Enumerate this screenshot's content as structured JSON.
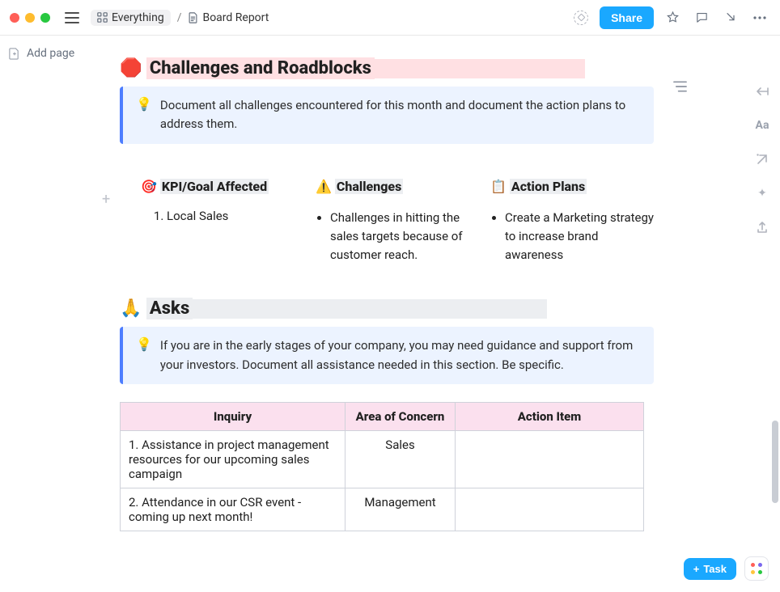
{
  "breadcrumbs": {
    "root": "Everything",
    "page": "Board Report"
  },
  "toolbar": {
    "share": "Share"
  },
  "sidebar": {
    "add_page": "Add page"
  },
  "sections": {
    "challenges": {
      "emoji": "🛑",
      "title": "Challenges and Roadblocks",
      "tip_emoji": "💡",
      "tip": "Document all challenges encountered for this month and document the action plans to address them.",
      "cols": {
        "kpi": {
          "emoji": "🎯",
          "label": "KPI/Goal Affected",
          "items": [
            "Local Sales"
          ]
        },
        "ch": {
          "emoji": "⚠️",
          "label": "Challenges",
          "items": [
            "Challenges in hitting the sales targets because of customer reach."
          ]
        },
        "ap": {
          "emoji": "📋",
          "label": "Action Plans",
          "items": [
            "Create a Marketing strategy to increase brand awareness"
          ]
        }
      }
    },
    "asks": {
      "emoji": "🙏",
      "title": "Asks",
      "tip_emoji": "💡",
      "tip": "If you are in the early stages of your company, you may need guidance and support from your investors. Document all assistance needed in this section. Be specific.",
      "table": {
        "headers": [
          "Inquiry",
          "Area of Concern",
          "Action Item"
        ],
        "rows": [
          {
            "inquiry": "1. Assistance in project management resources for our upcoming sales campaign",
            "area": "Sales",
            "action": ""
          },
          {
            "inquiry": "2. Attendance in our CSR event - coming up next month!",
            "area": "Management",
            "action": ""
          }
        ]
      }
    }
  },
  "fab": {
    "task": "Task"
  },
  "right_rail": {
    "font": "Aa"
  }
}
